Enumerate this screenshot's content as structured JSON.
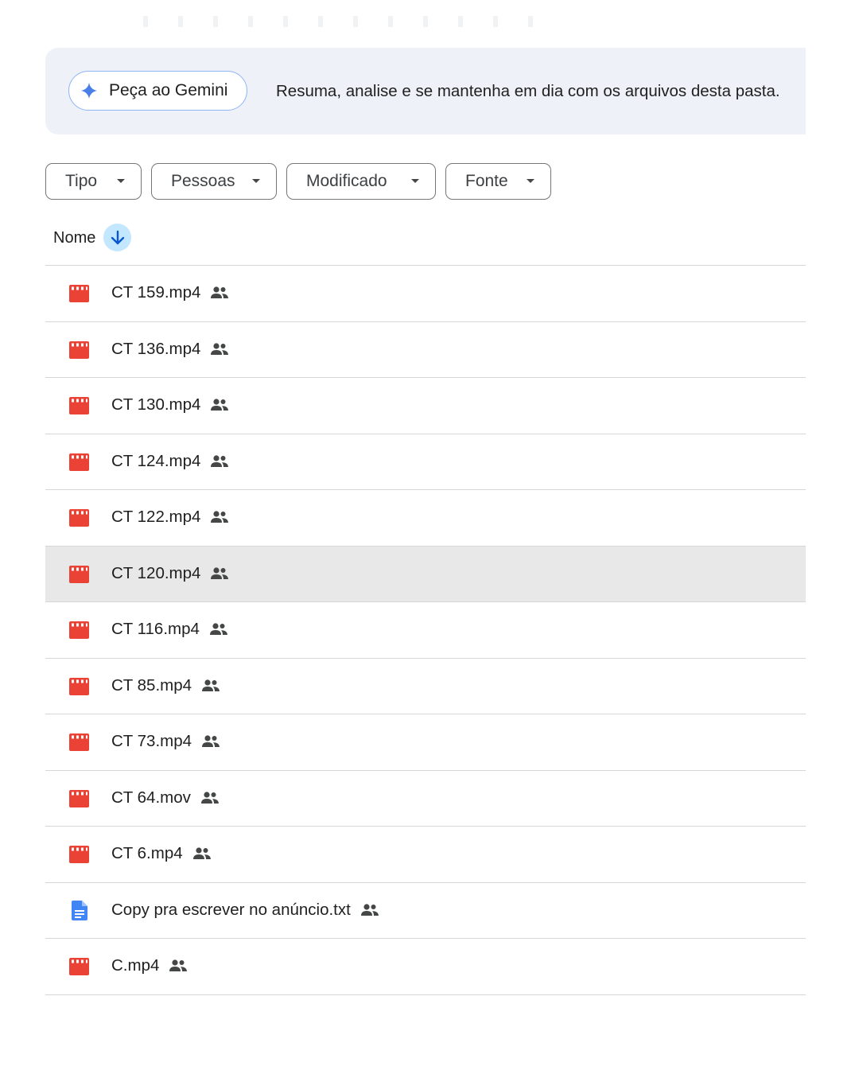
{
  "gemini": {
    "button_label": "Peça ao Gemini",
    "description": "Resuma, analise e se mantenha em dia com os arquivos desta pasta."
  },
  "filters": [
    {
      "label": "Tipo"
    },
    {
      "label": "Pessoas"
    },
    {
      "label": "Modificado"
    },
    {
      "label": "Fonte"
    }
  ],
  "list_header": {
    "name_label": "Nome",
    "sort": "descending"
  },
  "files": [
    {
      "name": "CT 159.mp4",
      "type": "video",
      "shared": true
    },
    {
      "name": "CT 136.mp4",
      "type": "video",
      "shared": true
    },
    {
      "name": "CT 130.mp4",
      "type": "video",
      "shared": true
    },
    {
      "name": "CT 124.mp4",
      "type": "video",
      "shared": true
    },
    {
      "name": "CT 122.mp4",
      "type": "video",
      "shared": true
    },
    {
      "name": "CT 120.mp4",
      "type": "video",
      "shared": true,
      "selected": true
    },
    {
      "name": "CT 116.mp4",
      "type": "video",
      "shared": true
    },
    {
      "name": "CT 85.mp4",
      "type": "video",
      "shared": true
    },
    {
      "name": "CT 73.mp4",
      "type": "video",
      "shared": true
    },
    {
      "name": "CT 64.mov",
      "type": "video",
      "shared": true
    },
    {
      "name": "CT 6.mp4",
      "type": "video",
      "shared": true
    },
    {
      "name": "Copy pra escrever no anúncio.txt",
      "type": "document",
      "shared": true
    },
    {
      "name": "C.mp4",
      "type": "video",
      "shared": true
    }
  ],
  "colors": {
    "video_icon": "#ea4335",
    "doc_icon": "#4285f4",
    "accent": "#c2e7ff",
    "selected_row": "#e8e8e8"
  }
}
